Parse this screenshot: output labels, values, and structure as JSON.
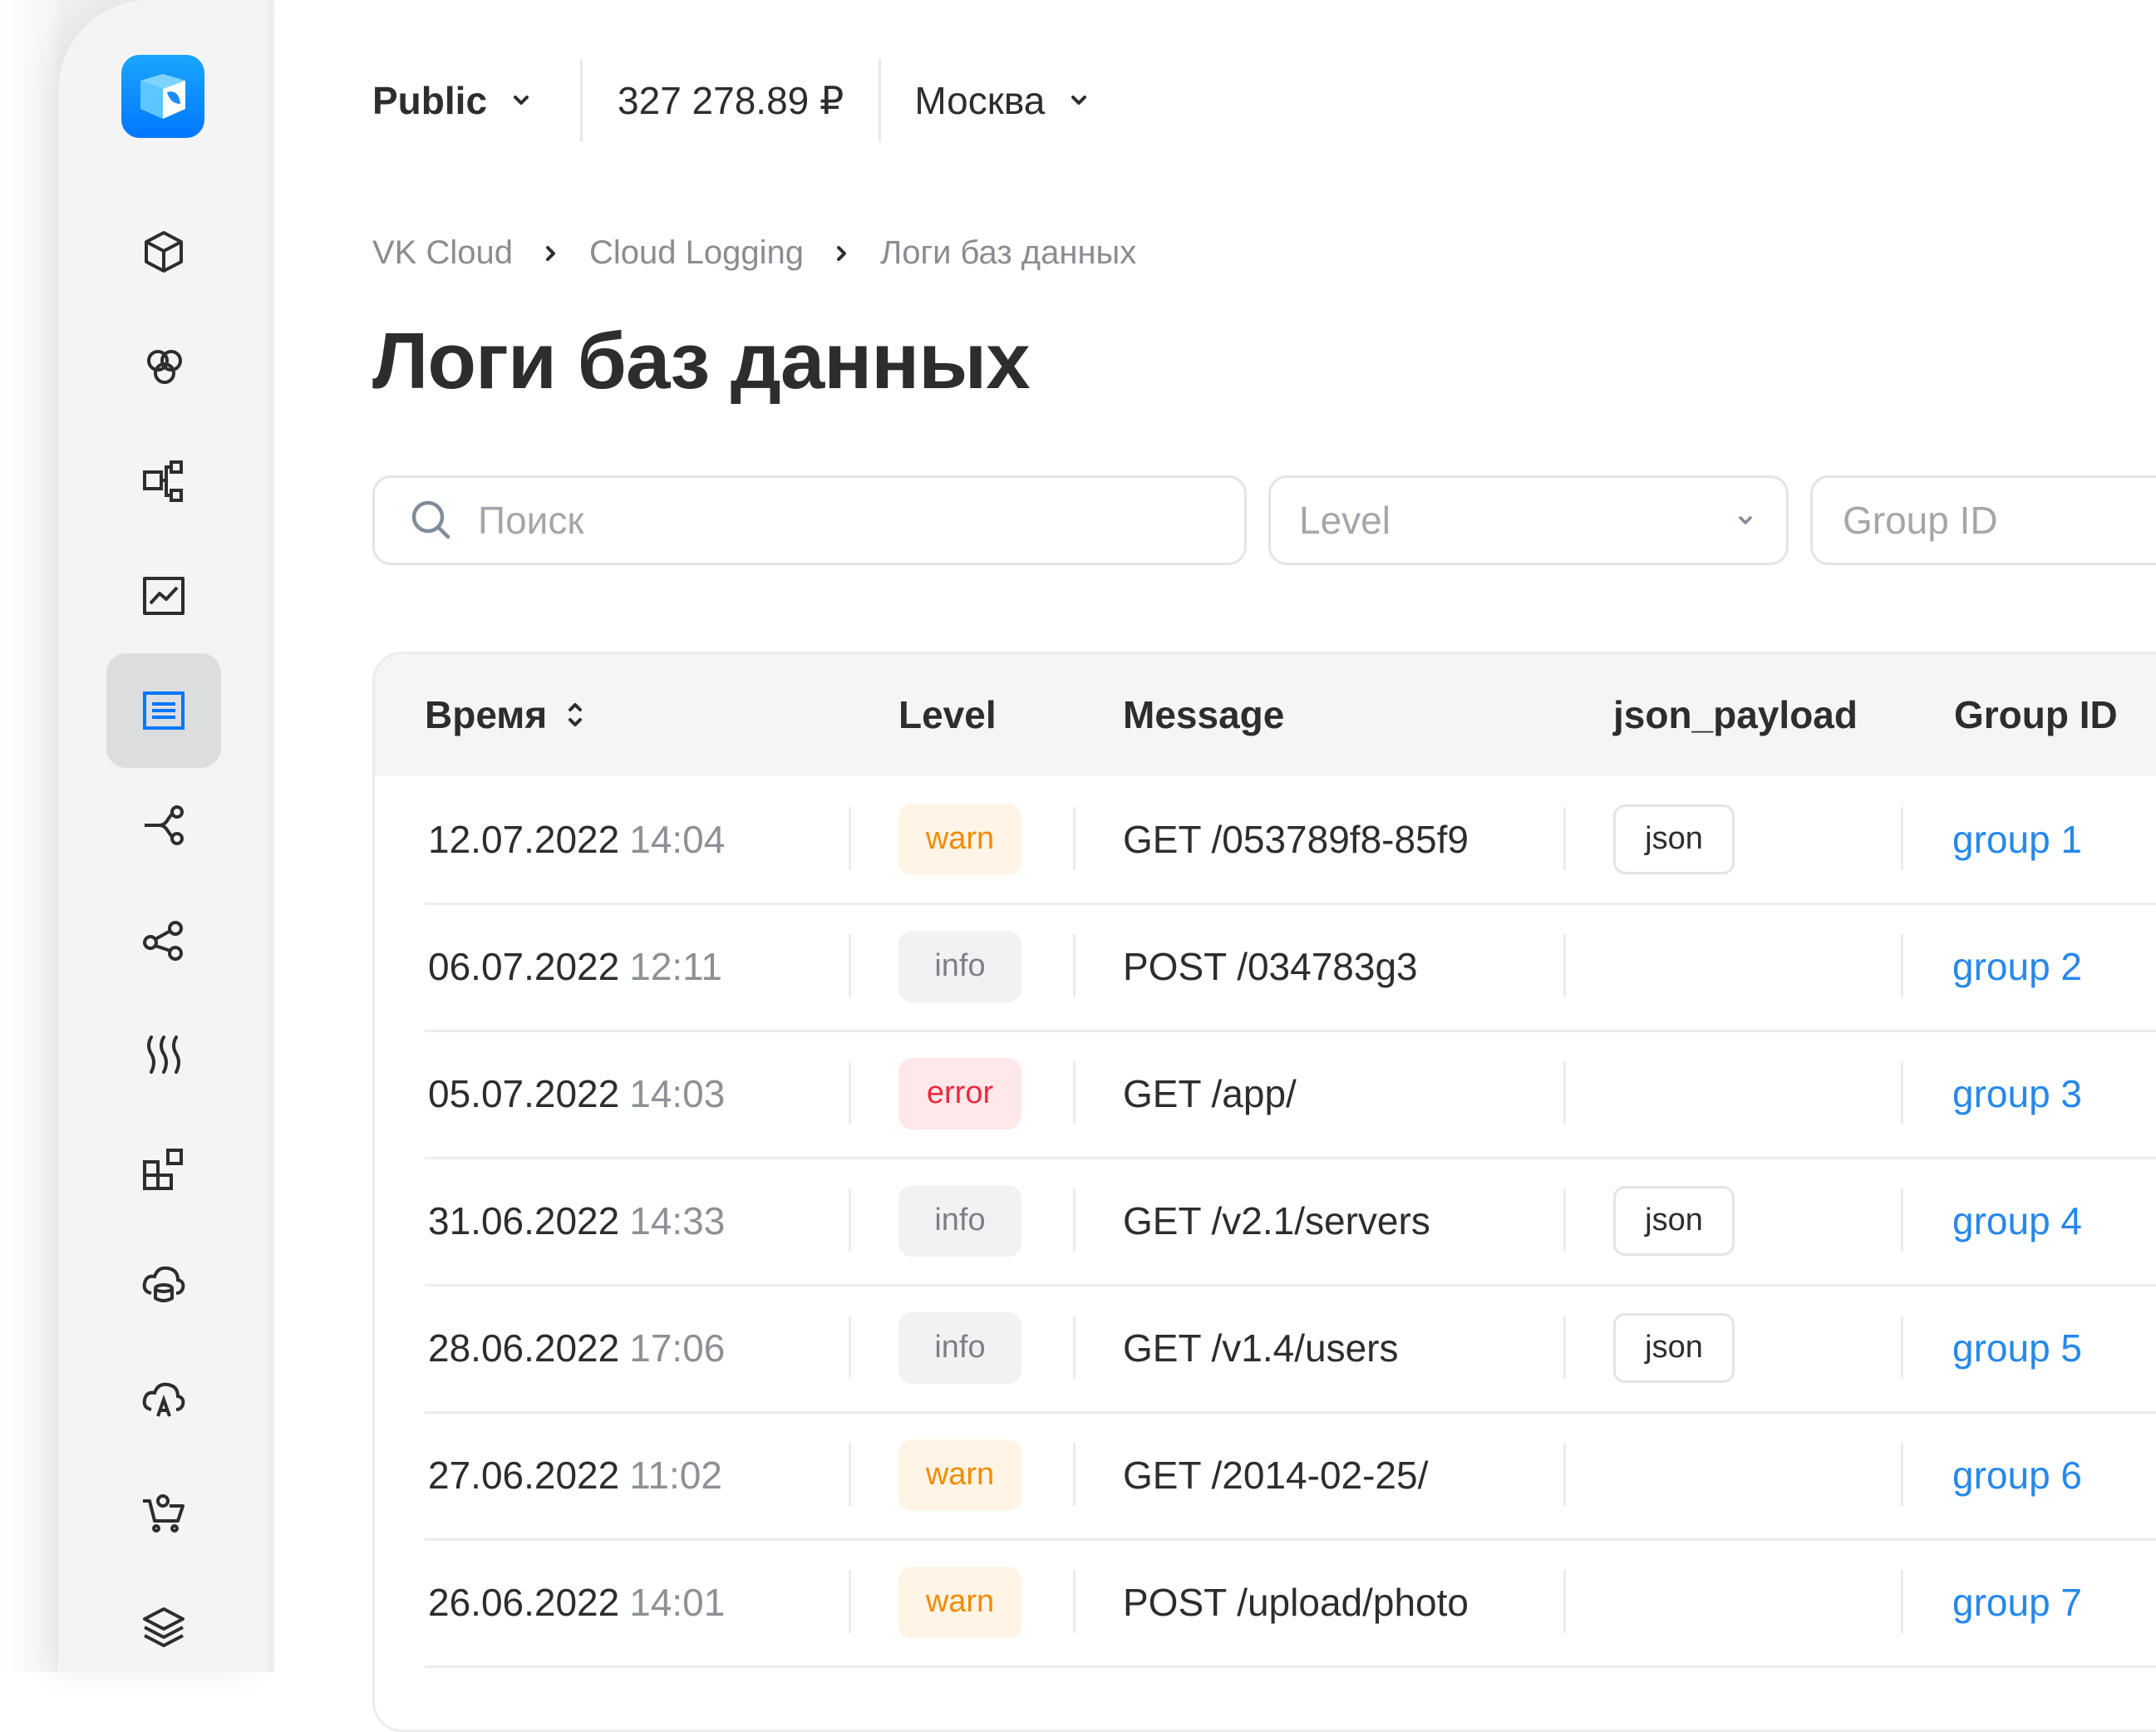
{
  "colors": {
    "accent": "#0077ff",
    "link": "#2688eb",
    "warn": "#f08c00",
    "error": "#ed2a3e",
    "info": "#7d8085",
    "sidebar_bg": "#f4f4f5"
  },
  "sidebar": {
    "logo_icon": "vk-cloud-logo-icon",
    "items": [
      {
        "icon": "cube-icon"
      },
      {
        "icon": "hexagon-cluster-icon"
      },
      {
        "icon": "network-hierarchy-icon"
      },
      {
        "icon": "chart-line-icon"
      },
      {
        "icon": "list-document-icon",
        "active": true
      },
      {
        "icon": "routes-icon"
      },
      {
        "icon": "share-nodes-icon"
      },
      {
        "icon": "heat-waves-icon"
      },
      {
        "icon": "widgets-icon"
      },
      {
        "icon": "cloud-database-icon"
      },
      {
        "icon": "cloud-a-icon"
      },
      {
        "icon": "cart-icon"
      },
      {
        "icon": "layers-icon"
      }
    ]
  },
  "topbar": {
    "project": "Public",
    "balance": "327 278.89 ₽",
    "region": "Москва"
  },
  "breadcrumb": [
    "VK Cloud",
    "Cloud Logging",
    "Логи баз данных"
  ],
  "page_title": "Логи баз данных",
  "filters": {
    "search_placeholder": "Поиск",
    "level_placeholder": "Level",
    "group_placeholder": "Group ID"
  },
  "table": {
    "columns": [
      "Время",
      "Level",
      "Message",
      "json_payload",
      "Group ID"
    ],
    "rows": [
      {
        "date": "12.07.2022",
        "time": "14:04",
        "level": "warn",
        "message": "GET /053789f8-85f9",
        "json": "json",
        "group": "group 1"
      },
      {
        "date": "06.07.2022",
        "time": "12:11",
        "level": "info",
        "message": "POST /034783g3",
        "json": "",
        "group": "group 2"
      },
      {
        "date": "05.07.2022",
        "time": "14:03",
        "level": "error",
        "message": "GET /app/",
        "json": "",
        "group": "group 3"
      },
      {
        "date": "31.06.2022",
        "time": "14:33",
        "level": "info",
        "message": "GET /v2.1/servers",
        "json": "json",
        "group": "group 4"
      },
      {
        "date": "28.06.2022",
        "time": "17:06",
        "level": "info",
        "message": "GET /v1.4/users",
        "json": "json",
        "group": "group 5"
      },
      {
        "date": "27.06.2022",
        "time": "11:02",
        "level": "warn",
        "message": "GET /2014-02-25/",
        "json": "",
        "group": "group 6"
      },
      {
        "date": "26.06.2022",
        "time": "14:01",
        "level": "warn",
        "message": "POST /upload/photo",
        "json": "",
        "group": "group 7"
      }
    ]
  }
}
